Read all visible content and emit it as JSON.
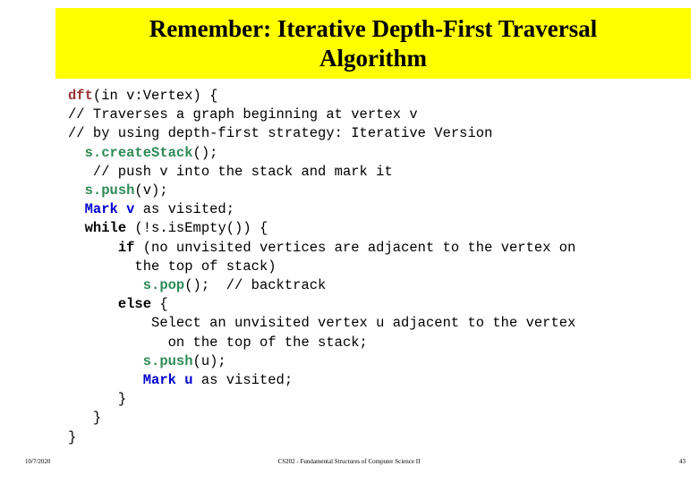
{
  "slide": {
    "title": "Remember: Iterative Depth-First Traversal Algorithm",
    "title_line1": "Remember: Iterative Depth-First Traversal",
    "title_line2": "Algorithm",
    "banner_color": "#ffff00",
    "title_color": "#000000"
  },
  "colors": {
    "function_name": "#993333",
    "method_call": "#2e8b57",
    "mark_keyword": "#0000cc",
    "control_keyword": "#000000",
    "plain_text": "#000000",
    "background": "#ffffff"
  },
  "code": {
    "language": "pseudocode",
    "lines": [
      {
        "indent": "",
        "tokens": [
          {
            "text": "dft",
            "style": "fn"
          },
          {
            "text": "(in v:Vertex) {",
            "style": "plain"
          }
        ]
      },
      {
        "indent": "",
        "tokens": [
          {
            "text": "// Traverses a graph beginning at vertex v",
            "style": "plain"
          }
        ]
      },
      {
        "indent": "",
        "tokens": [
          {
            "text": "// by using depth-first strategy: Iterative Version",
            "style": "plain"
          }
        ]
      },
      {
        "indent": "  ",
        "tokens": [
          {
            "text": "s.createStack",
            "style": "method"
          },
          {
            "text": "();",
            "style": "plain"
          }
        ]
      },
      {
        "indent": "   ",
        "tokens": [
          {
            "text": "// push v into the stack and mark it",
            "style": "plain"
          }
        ]
      },
      {
        "indent": "  ",
        "tokens": [
          {
            "text": "s.push",
            "style": "method"
          },
          {
            "text": "(v);",
            "style": "plain"
          }
        ]
      },
      {
        "indent": "  ",
        "tokens": [
          {
            "text": "Mark v",
            "style": "mark"
          },
          {
            "text": " as visited;",
            "style": "plain"
          }
        ]
      },
      {
        "indent": "  ",
        "tokens": [
          {
            "text": "while",
            "style": "kw"
          },
          {
            "text": " (!s.isEmpty()) {",
            "style": "plain"
          }
        ]
      },
      {
        "indent": "      ",
        "tokens": [
          {
            "text": "if",
            "style": "kw"
          },
          {
            "text": " (no unvisited vertices are adjacent to the vertex on",
            "style": "plain"
          }
        ]
      },
      {
        "indent": "        ",
        "tokens": [
          {
            "text": "the top of stack)",
            "style": "plain"
          }
        ]
      },
      {
        "indent": "         ",
        "tokens": [
          {
            "text": "s.pop",
            "style": "method"
          },
          {
            "text": "();  // backtrack",
            "style": "plain"
          }
        ]
      },
      {
        "indent": "      ",
        "tokens": [
          {
            "text": "else",
            "style": "kw"
          },
          {
            "text": " {",
            "style": "plain"
          }
        ]
      },
      {
        "indent": "          ",
        "tokens": [
          {
            "text": "Select an unvisited vertex u adjacent to the vertex",
            "style": "plain"
          }
        ]
      },
      {
        "indent": "            ",
        "tokens": [
          {
            "text": "on the top of the stack;",
            "style": "plain"
          }
        ]
      },
      {
        "indent": "         ",
        "tokens": [
          {
            "text": "s.push",
            "style": "method"
          },
          {
            "text": "(u);",
            "style": "plain"
          }
        ]
      },
      {
        "indent": "         ",
        "tokens": [
          {
            "text": "Mark u",
            "style": "mark"
          },
          {
            "text": " as visited;",
            "style": "plain"
          }
        ]
      },
      {
        "indent": "      ",
        "tokens": [
          {
            "text": "}",
            "style": "plain"
          }
        ]
      },
      {
        "indent": "   ",
        "tokens": [
          {
            "text": "}",
            "style": "plain"
          }
        ]
      },
      {
        "indent": "",
        "tokens": [
          {
            "text": "}",
            "style": "plain"
          }
        ]
      }
    ]
  },
  "footer": {
    "date": "10/7/2020",
    "course": "CS202 - Fundamental Structures of Computer Science II",
    "page_number": "43"
  }
}
